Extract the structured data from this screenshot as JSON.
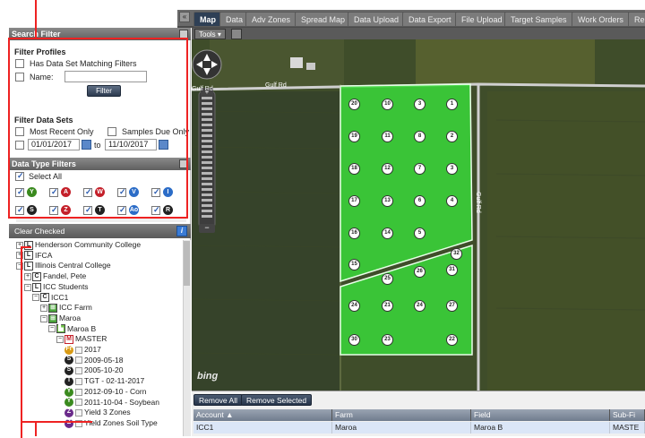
{
  "nav": {
    "collapse_icon": "double-chevron-left-icon",
    "tabs": [
      "Map",
      "Data",
      "Adv Zones",
      "Spread Map",
      "Data Upload",
      "Data Export",
      "File Upload",
      "Target Samples",
      "Work Orders",
      "Reports"
    ],
    "active_tab": "Map"
  },
  "search_filter": {
    "title": "Search Filter",
    "filter_profiles_title": "Filter Profiles",
    "has_data_set_label": "Has Data Set Matching Filters",
    "name_label": "Name:",
    "name_value": "",
    "filter_button": "Filter",
    "filter_data_sets_title": "Filter Data Sets",
    "most_recent_label": "Most Recent Only",
    "samples_due_label": "Samples Due Only",
    "date_from": "01/01/2017",
    "date_to_label": "to",
    "date_to": "11/10/2017"
  },
  "data_type_filters": {
    "title": "Data Type Filters",
    "select_all_label": "Select All",
    "icons": [
      {
        "letter": "Y",
        "color": "#3a8a1e"
      },
      {
        "letter": "A",
        "color": "#c4202a"
      },
      {
        "letter": "W",
        "color": "#c4202a"
      },
      {
        "letter": "V",
        "color": "#2b6cc7"
      },
      {
        "letter": "I",
        "color": "#2b6cc7"
      },
      {
        "letter": "S",
        "color": "#222222"
      },
      {
        "letter": "Z",
        "color": "#c4202a"
      },
      {
        "letter": "T",
        "color": "#222222"
      },
      {
        "letter": "Ao",
        "color": "#2b6cc7"
      },
      {
        "letter": "R",
        "color": "#222222"
      }
    ]
  },
  "tree": {
    "clear_checked": "Clear Checked",
    "info_icon": "info-icon",
    "nodes": [
      {
        "label": "Henderson Community College",
        "icon": "L",
        "type": "box"
      },
      {
        "label": "IFCA",
        "icon": "L",
        "type": "box"
      },
      {
        "label": "Illinois Central College",
        "icon": "L",
        "type": "box"
      },
      {
        "label": "Fandel, Pete",
        "icon": "C",
        "type": "box"
      },
      {
        "label": "ICC Students",
        "icon": "L",
        "type": "box"
      },
      {
        "label": "ICC1",
        "icon": "C",
        "type": "box"
      },
      {
        "label": "ICC Farm",
        "icon": "farm",
        "type": "box"
      },
      {
        "label": "Maroa",
        "icon": "farm",
        "type": "box"
      },
      {
        "label": "Maroa B",
        "icon": "field",
        "type": "box"
      },
      {
        "label": "MASTER",
        "icon": "M",
        "type": "box"
      },
      {
        "label": "2017",
        "icon": "Fr",
        "type": "round"
      },
      {
        "label": "2009-05-18",
        "icon": "S",
        "type": "round"
      },
      {
        "label": "2005-10-20",
        "icon": "S",
        "type": "round"
      },
      {
        "label": "TGT - 02-11-2017",
        "icon": "T",
        "type": "round"
      },
      {
        "label": "2012-09-10 - Corn",
        "icon": "Y",
        "type": "round"
      },
      {
        "label": "2011-10-04 - Soybean",
        "icon": "Y",
        "type": "round"
      },
      {
        "label": "Yield 3 Zones",
        "icon": "Z",
        "type": "round"
      },
      {
        "label": "Yield Zones Soil Type",
        "icon": "Z",
        "type": "round"
      }
    ]
  },
  "map": {
    "tools_label": "Tools",
    "road_label_1": "Gulf Rd",
    "road_label_2": "Gulf Rd",
    "road_label_3": "Gulf Rd",
    "attribution": "bing",
    "samples": [
      "20",
      "10",
      "3",
      "1",
      "19",
      "11",
      "8",
      "2",
      "18",
      "12",
      "7",
      "3",
      "17",
      "13",
      "6",
      "4",
      "16",
      "14",
      "5",
      "32",
      "15",
      "25",
      "26",
      "31",
      "24",
      "21",
      "24",
      "27",
      "30",
      "23",
      "22",
      "29"
    ]
  },
  "table": {
    "remove_all": "Remove All",
    "remove_selected": "Remove Selected",
    "headers": [
      "Account ▲",
      "Farm",
      "Field",
      "Sub-Fi"
    ],
    "row": [
      "ICC1",
      "Maroa",
      "Maroa B",
      "MASTE"
    ]
  }
}
